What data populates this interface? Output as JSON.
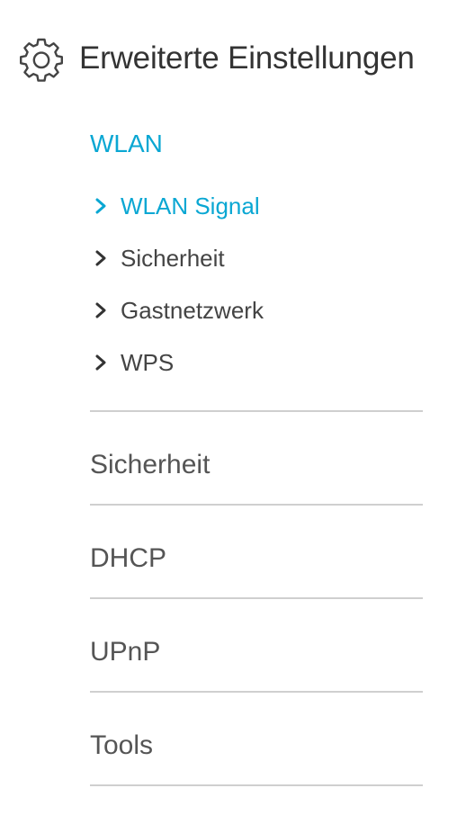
{
  "header": {
    "icon": "gear-icon",
    "title": "Erweiterte Einstellungen"
  },
  "active_section": {
    "title": "WLAN",
    "items": [
      {
        "label": "WLAN Signal",
        "active": true,
        "icon": "chevron-right-icon"
      },
      {
        "label": "Sicherheit",
        "active": false,
        "icon": "chevron-right-icon"
      },
      {
        "label": "Gastnetzwerk",
        "active": false,
        "icon": "chevron-right-icon"
      },
      {
        "label": "WPS",
        "active": false,
        "icon": "chevron-right-icon"
      }
    ]
  },
  "sections": [
    {
      "label": "Sicherheit"
    },
    {
      "label": "DHCP"
    },
    {
      "label": "UPnP"
    },
    {
      "label": "Tools"
    }
  ],
  "colors": {
    "accent": "#0aa7d3",
    "text": "#333333",
    "divider": "#cfcfcf"
  }
}
